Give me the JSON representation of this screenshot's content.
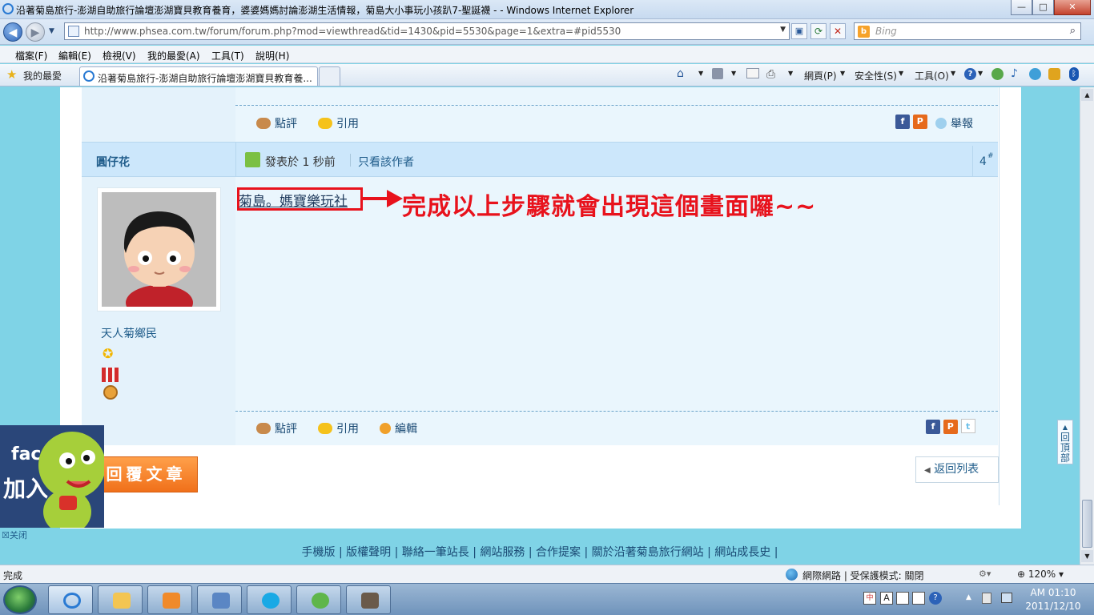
{
  "window": {
    "title": "沿著菊島旅行-澎湖自助旅行論壇澎湖寶貝教育養育，婆婆媽媽討論澎湖生活情報，菊島大小事玩小孩趴7-聖誕襪 - - Windows Internet Explorer",
    "minimize": "—",
    "maximize": "□",
    "close": "✕"
  },
  "browser": {
    "url": "http://www.phsea.com.tw/forum/forum.php?mod=viewthread&tid=1430&pid=5530&page=1&extra=#pid5530",
    "search_placeholder": "Bing",
    "menu": [
      "檔案(F)",
      "編輯(E)",
      "檢視(V)",
      "我的最愛(A)",
      "工具(T)",
      "說明(H)"
    ],
    "favorites_label": "我的最愛",
    "tab_title": "沿著菊島旅行-澎湖自助旅行論壇澎湖寶貝教育養...",
    "command_bar": [
      "網頁(P)",
      "安全性(S)",
      "工具(O)"
    ]
  },
  "post": {
    "top_actions": {
      "rate": "點評",
      "quote": "引用",
      "report": "舉報"
    },
    "author": "圓仔花",
    "posted_label": "發表於",
    "posted_time": "1 秒前",
    "only_author": "只看該作者",
    "floor": "4",
    "floor_mark": "#",
    "user_title": "天人菊鄉民",
    "content_link": "菊島。媽寶樂玩社",
    "annotation": "完成以上步驟就會出現這個畫面囉~~",
    "bottom_actions": {
      "rate": "點評",
      "quote": "引用",
      "edit": "編輯"
    },
    "reply_button": "回覆文章",
    "back_button": "返回列表",
    "back_to_top": "回頂部"
  },
  "float_ad": {
    "line1": "fac",
    "line2": "加入",
    "close": "关闭"
  },
  "footer": {
    "links": [
      "手機版",
      "版權聲明",
      "聯絡一筆站長",
      "網站服務",
      "合作提案",
      "關於沿著菊島旅行網站",
      "網站成長史"
    ]
  },
  "status": {
    "left": "完成",
    "zone": "網際網路 | 受保護模式: 關閉",
    "zoom": "120%"
  },
  "clock": {
    "time": "AM 01:10",
    "date": "2011/12/10"
  },
  "colors": {
    "accent": "#1f5c8a",
    "annotation": "#e8121c",
    "page_bg": "#7fd3e6",
    "reply_btn": "#f47d20"
  }
}
